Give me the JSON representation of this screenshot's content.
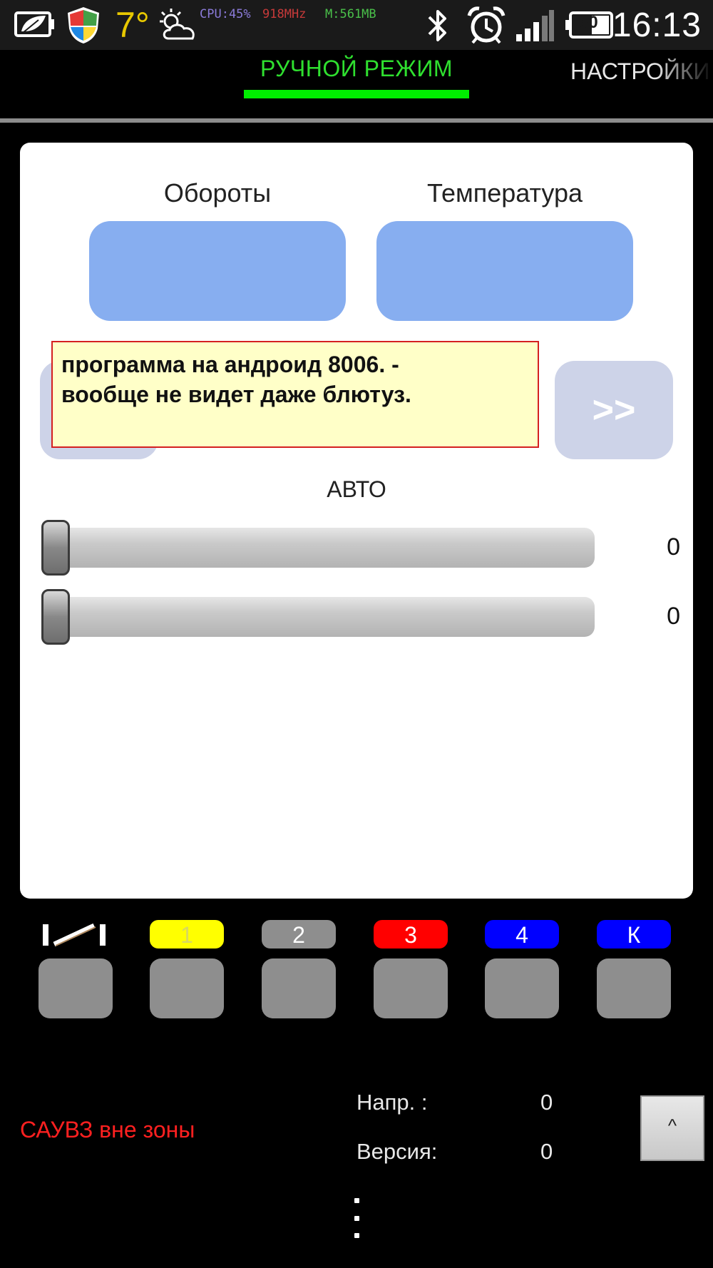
{
  "status_bar": {
    "temperature": "7°",
    "cpu_text": "CPU:45%",
    "freq_text": "918MHz",
    "mem_text": "M:561MB",
    "battery_level": "50",
    "clock": "16:13",
    "icons": [
      "leaf-battery-icon",
      "shield-icon",
      "weather-icon",
      "bluetooth-icon",
      "alarm-icon",
      "signal-icon",
      "battery-icon"
    ]
  },
  "tabs": {
    "manual": "РУЧНОЙ РЕЖИМ",
    "settings": "НАСТРОЙКИ"
  },
  "gauges": {
    "rpm_label": "Обороты",
    "temp_label": "Температура"
  },
  "controls": {
    "next_label": ">>",
    "auto_label": "АВТО",
    "slider1_value": "0",
    "slider2_value": "0",
    "slider1_fraction": 0,
    "slider2_fraction": 0
  },
  "tooltip": {
    "line1": "программа на андроид 8006. -",
    "line2": "вообще не видет даже блютуз."
  },
  "channels": [
    {
      "label": "",
      "color": "#000000",
      "text_color": "#ffffff"
    },
    {
      "label": "1",
      "color": "#ffff00",
      "text_color": "#d8d860"
    },
    {
      "label": "2",
      "color": "#8e8e8e",
      "text_color": "#ffffff"
    },
    {
      "label": "3",
      "color": "#ff0000",
      "text_color": "#ffffff"
    },
    {
      "label": "4",
      "color": "#0000ff",
      "text_color": "#ffffff"
    },
    {
      "label": "К",
      "color": "#0000ff",
      "text_color": "#ffffff"
    }
  ],
  "footer": {
    "status": "САУВЗ вне зоны",
    "voltage_label": "Напр. :",
    "voltage_value": "0",
    "version_label": "Версия:",
    "version_value": "0",
    "up_label": "^"
  },
  "colors": {
    "accent_green": "#00ee00",
    "gauge_blue": "#87aef0",
    "status_red": "#ff2020",
    "tooltip_bg": "#ffffc8"
  }
}
